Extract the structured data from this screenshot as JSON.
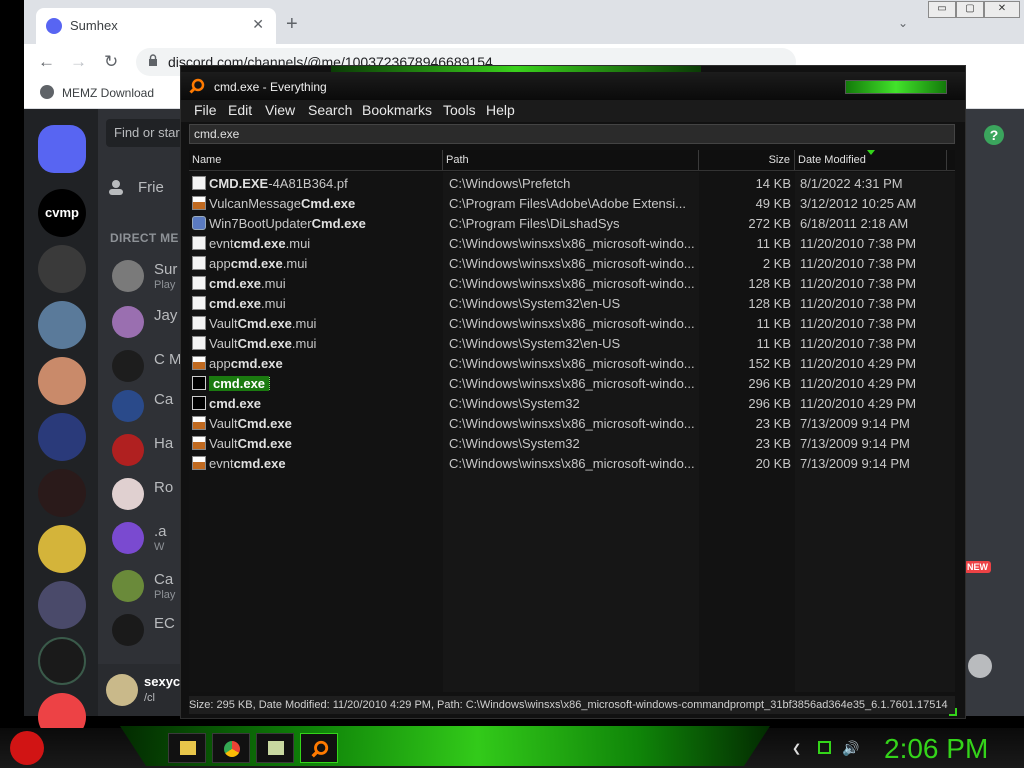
{
  "browser": {
    "tab_title": "Sumhex",
    "tab_close": "✕",
    "new_tab": "+",
    "tab_search": "⌄",
    "window_controls": [
      "▭",
      "▢",
      "✕"
    ],
    "url": "discord.com/channels/@me/1003723678946689154",
    "bookmark": "MEMZ Download"
  },
  "discord": {
    "server_label": "cvmp",
    "search_placeholder": "Find or star",
    "friends_label": "Frie",
    "dm_header": "DIRECT ME",
    "dms": [
      {
        "name": "Sur",
        "sub": "Play",
        "color": "#7a7a7a"
      },
      {
        "name": "Jay",
        "sub": "",
        "color": "#9a6fb0"
      },
      {
        "name": "C M",
        "sub": "",
        "color": "#1d1d1d"
      },
      {
        "name": "Ca",
        "sub": "",
        "color": "#2a4a8a"
      },
      {
        "name": "Ha",
        "sub": "",
        "color": "#b02020"
      },
      {
        "name": "Ro",
        "sub": "",
        "color": "#e0d0d0"
      },
      {
        "name": ".a",
        "sub": "W",
        "color": "#7a4ad0"
      },
      {
        "name": "Ca",
        "sub": "Play",
        "color": "#6a8a3a"
      },
      {
        "name": "EC",
        "sub": "",
        "color": "#1a1a1a"
      }
    ],
    "user_name": "sexyc",
    "user_tag": "/cl",
    "help": "?",
    "new_badge": "NEW"
  },
  "everything": {
    "title": "cmd.exe - Everything",
    "menu": [
      "File",
      "Edit",
      "View",
      "Search",
      "Bookmarks",
      "Tools",
      "Help"
    ],
    "search_value": "cmd.exe",
    "columns": [
      "Name",
      "Path",
      "Size",
      "Date Modified"
    ],
    "sorted_column": "Date Modified",
    "selected_row": 10,
    "rows": [
      {
        "name_pre": "",
        "name_hl": "CMD.EXE",
        "name_post": "-4A81B364.pf",
        "path": "C:\\Windows\\Prefetch",
        "size": "14 KB",
        "date": "8/1/2022 4:31 PM",
        "icon": "file"
      },
      {
        "name_pre": "VulcanMessage",
        "name_hl": "Cmd.exe",
        "name_post": "",
        "path": "C:\\Program Files\\Adobe\\Adobe Extensi...",
        "size": "49 KB",
        "date": "3/12/2012 10:25 AM",
        "icon": "exe"
      },
      {
        "name_pre": "Win7BootUpdater",
        "name_hl": "Cmd.exe",
        "name_post": "",
        "path": "C:\\Program Files\\DiLshadSys",
        "size": "272 KB",
        "date": "6/18/2011 2:18 AM",
        "icon": "app"
      },
      {
        "name_pre": "evnt",
        "name_hl": "cmd.exe",
        "name_post": ".mui",
        "path": "C:\\Windows\\winsxs\\x86_microsoft-windo...",
        "size": "11 KB",
        "date": "11/20/2010 7:38 PM",
        "icon": "file"
      },
      {
        "name_pre": "app",
        "name_hl": "cmd.exe",
        "name_post": ".mui",
        "path": "C:\\Windows\\winsxs\\x86_microsoft-windo...",
        "size": "2 KB",
        "date": "11/20/2010 7:38 PM",
        "icon": "file"
      },
      {
        "name_pre": "",
        "name_hl": "cmd.exe",
        "name_post": ".mui",
        "path": "C:\\Windows\\winsxs\\x86_microsoft-windo...",
        "size": "128 KB",
        "date": "11/20/2010 7:38 PM",
        "icon": "file"
      },
      {
        "name_pre": "",
        "name_hl": "cmd.exe",
        "name_post": ".mui",
        "path": "C:\\Windows\\System32\\en-US",
        "size": "128 KB",
        "date": "11/20/2010 7:38 PM",
        "icon": "file"
      },
      {
        "name_pre": "Vault",
        "name_hl": "Cmd.exe",
        "name_post": ".mui",
        "path": "C:\\Windows\\winsxs\\x86_microsoft-windo...",
        "size": "11 KB",
        "date": "11/20/2010 7:38 PM",
        "icon": "file"
      },
      {
        "name_pre": "Vault",
        "name_hl": "Cmd.exe",
        "name_post": ".mui",
        "path": "C:\\Windows\\System32\\en-US",
        "size": "11 KB",
        "date": "11/20/2010 7:38 PM",
        "icon": "file"
      },
      {
        "name_pre": "app",
        "name_hl": "cmd.exe",
        "name_post": "",
        "path": "C:\\Windows\\winsxs\\x86_microsoft-windo...",
        "size": "152 KB",
        "date": "11/20/2010 4:29 PM",
        "icon": "exe"
      },
      {
        "name_pre": "",
        "name_hl": "cmd.exe",
        "name_post": "",
        "path": "C:\\Windows\\winsxs\\x86_microsoft-windo...",
        "size": "296 KB",
        "date": "11/20/2010 4:29 PM",
        "icon": "cmd"
      },
      {
        "name_pre": "",
        "name_hl": "cmd.exe",
        "name_post": "",
        "path": "C:\\Windows\\System32",
        "size": "296 KB",
        "date": "11/20/2010 4:29 PM",
        "icon": "cmd"
      },
      {
        "name_pre": "Vault",
        "name_hl": "Cmd.exe",
        "name_post": "",
        "path": "C:\\Windows\\winsxs\\x86_microsoft-windo...",
        "size": "23 KB",
        "date": "7/13/2009 9:14 PM",
        "icon": "exe"
      },
      {
        "name_pre": "Vault",
        "name_hl": "Cmd.exe",
        "name_post": "",
        "path": "C:\\Windows\\System32",
        "size": "23 KB",
        "date": "7/13/2009 9:14 PM",
        "icon": "exe"
      },
      {
        "name_pre": "evnt",
        "name_hl": "cmd.exe",
        "name_post": "",
        "path": "C:\\Windows\\winsxs\\x86_microsoft-windo...",
        "size": "20 KB",
        "date": "7/13/2009 9:14 PM",
        "icon": "exe"
      }
    ],
    "status": "Size: 295 KB, Date Modified: 11/20/2010 4:29 PM, Path: C:\\Windows\\winsxs\\x86_microsoft-windows-commandprompt_31bf3856ad364e35_6.1.7601.17514"
  },
  "taskbar": {
    "clock": "2:06 PM",
    "tray_chevron": "❮",
    "volume": "🔊"
  },
  "colors": {
    "accent_green": "#34d41a",
    "selection_green": "#1b7a10",
    "discord_blurple": "#5865f2"
  }
}
